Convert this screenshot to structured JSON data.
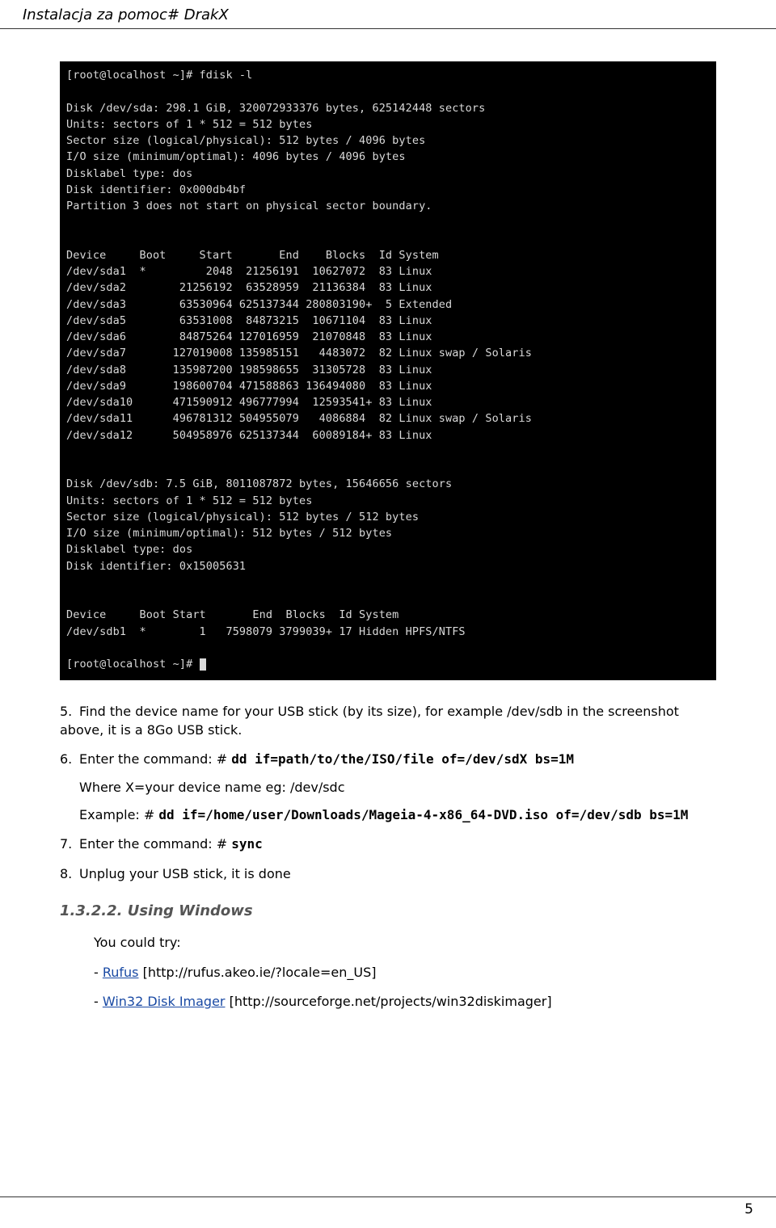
{
  "header_title": "Instalacja za pomoc# DrakX",
  "terminal": {
    "prompt1": "[root@localhost ~]# fdisk -l",
    "diskA": {
      "l1": "Disk /dev/sda: 298.1 GiB, 320072933376 bytes, 625142448 sectors",
      "l2": "Units: sectors of 1 * 512 = 512 bytes",
      "l3": "Sector size (logical/physical): 512 bytes / 4096 bytes",
      "l4": "I/O size (minimum/optimal): 4096 bytes / 4096 bytes",
      "l5": "Disklabel type: dos",
      "l6": "Disk identifier: 0x000db4bf",
      "l7": "Partition 3 does not start on physical sector boundary."
    },
    "tableA_header": "Device     Boot     Start       End    Blocks  Id System",
    "tableA": {
      "r1": "/dev/sda1  *         2048  21256191  10627072  83 Linux",
      "r2": "/dev/sda2        21256192  63528959  21136384  83 Linux",
      "r3": "/dev/sda3        63530964 625137344 280803190+  5 Extended",
      "r4": "/dev/sda5        63531008  84873215  10671104  83 Linux",
      "r5": "/dev/sda6        84875264 127016959  21070848  83 Linux",
      "r6": "/dev/sda7       127019008 135985151   4483072  82 Linux swap / Solaris",
      "r7": "/dev/sda8       135987200 198598655  31305728  83 Linux",
      "r8": "/dev/sda9       198600704 471588863 136494080  83 Linux",
      "r9": "/dev/sda10      471590912 496777994  12593541+ 83 Linux",
      "r10": "/dev/sda11      496781312 504955079   4086884  82 Linux swap / Solaris",
      "r11": "/dev/sda12      504958976 625137344  60089184+ 83 Linux"
    },
    "diskB": {
      "l1": "Disk /dev/sdb: 7.5 GiB, 8011087872 bytes, 15646656 sectors",
      "l2": "Units: sectors of 1 * 512 = 512 bytes",
      "l3": "Sector size (logical/physical): 512 bytes / 512 bytes",
      "l4": "I/O size (minimum/optimal): 512 bytes / 512 bytes",
      "l5": "Disklabel type: dos",
      "l6": "Disk identifier: 0x15005631"
    },
    "tableB_header": "Device     Boot Start       End  Blocks  Id System",
    "tableB": {
      "r1": "/dev/sdb1  *        1   7598079 3799039+ 17 Hidden HPFS/NTFS"
    },
    "prompt2": "[root@localhost ~]# "
  },
  "steps": {
    "n5": "5.",
    "t5": "Find the device name for your USB stick (by its size), for example /dev/sdb in the screenshot above, it is a 8Go USB stick.",
    "n6": "6.",
    "t6_lead": "Enter the command: # ",
    "t6_cmd": "dd if=path/to/the/ISO/file of=/dev/sdX bs=1M",
    "t6_where": "Where X=your device name eg: /dev/sdc",
    "t6_ex_lead": "Example: # ",
    "t6_ex_cmd": "dd if=/home/user/Downloads/Mageia-4-x86_64-DVD.iso of=/dev/sdb bs=1M",
    "n7": "7.",
    "t7_lead": "Enter the command: # ",
    "t7_cmd": "sync",
    "n8": "8.",
    "t8": "Unplug your USB stick, it is done"
  },
  "section": {
    "num": "1.3.2.2. Using Windows",
    "try": "You could try:",
    "dash": "- ",
    "rufus_label": "Rufus",
    "rufus_url": " [http://rufus.akeo.ie/?locale=en_US]",
    "win32_label": "Win32 Disk Imager",
    "win32_url": " [http://sourceforge.net/projects/win32diskimager]"
  },
  "page_number": "5"
}
